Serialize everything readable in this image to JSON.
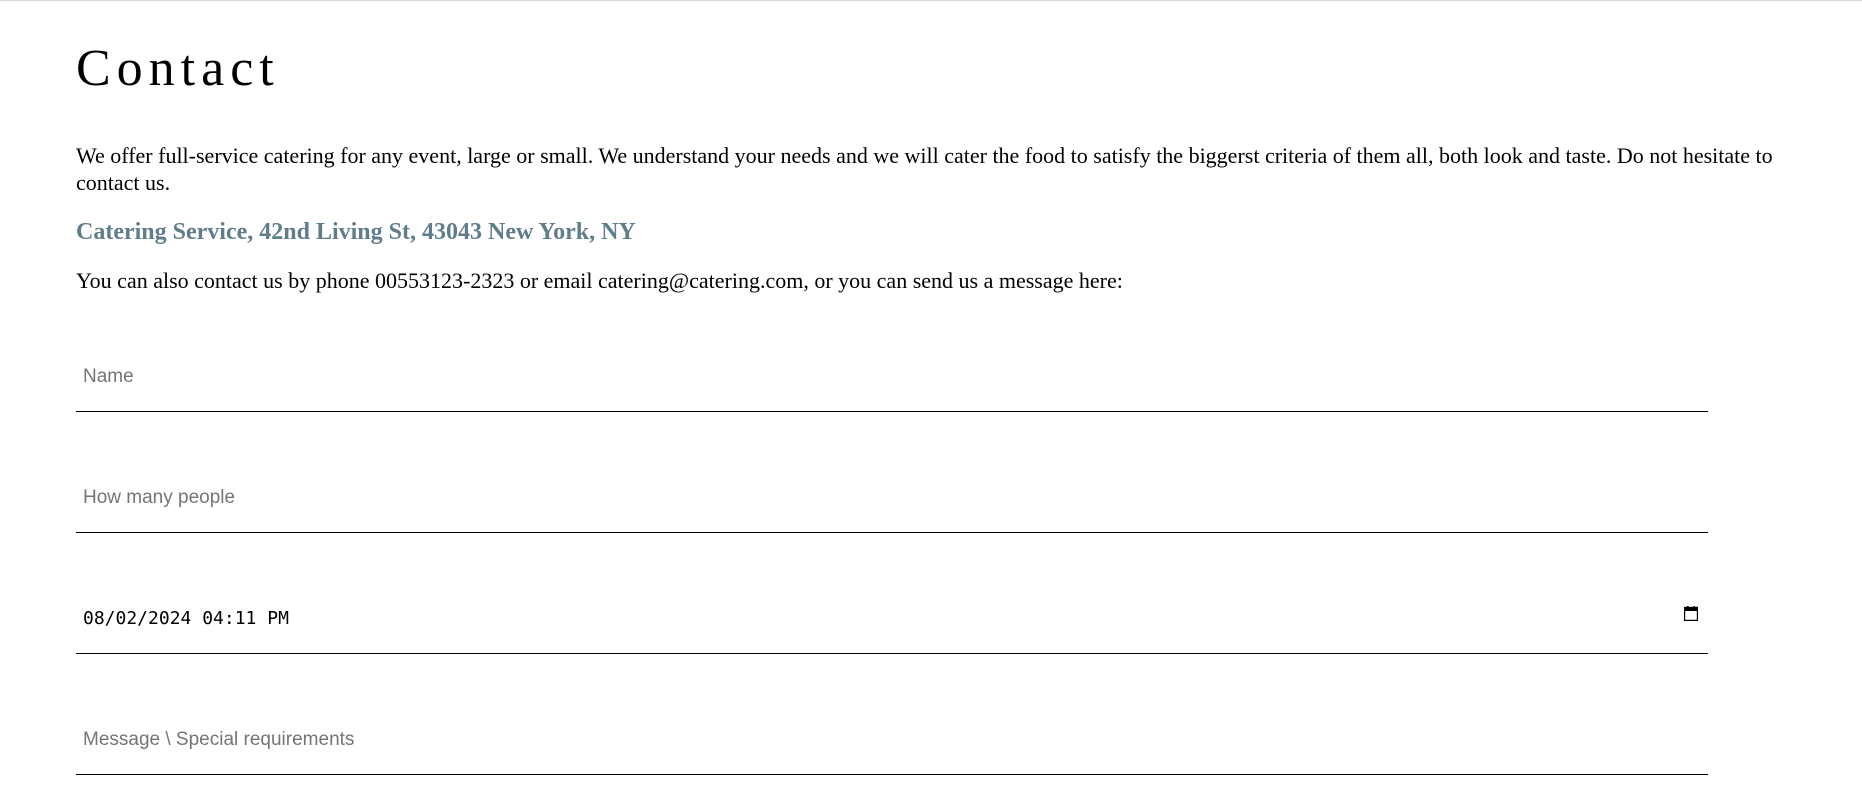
{
  "page": {
    "title": "Contact",
    "intro": "We offer full-service catering for any event, large or small. We understand your needs and we will cater the food to satisfy the biggerst criteria of them all, both look and taste. Do not hesitate to contact us.",
    "address": "Catering Service, 42nd Living St, 43043 New York, NY",
    "contact_line": "You can also contact us by phone 00553123-2323 or email catering@catering.com, or you can send us a message here:"
  },
  "form": {
    "name": {
      "value": "",
      "placeholder": "Name"
    },
    "people": {
      "value": "",
      "placeholder": "How many people"
    },
    "datetime": {
      "value": "08/02/2024 04:11 PM",
      "icon": "calendar-icon"
    },
    "message": {
      "value": "",
      "placeholder": "Message \\ Special requirements"
    }
  },
  "colors": {
    "address_accent": "#607d8b",
    "placeholder": "#757575",
    "underline": "#000000"
  }
}
